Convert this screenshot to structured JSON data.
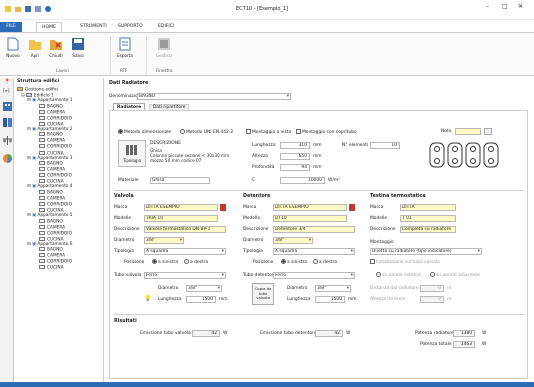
{
  "window": {
    "title": "EC710 - [Esempio_1]",
    "qa_icons": [
      "folder-icon",
      "save-icon",
      "disk-icon",
      "help-icon"
    ]
  },
  "ribbon": {
    "tabs": [
      "FILE",
      "HOME",
      "STRUMENTI",
      "SUPPORTO",
      "EDIFICI"
    ],
    "active_tab": "HOME",
    "groups": [
      {
        "name": "Lavori",
        "buttons": [
          "Nuovo",
          "Apri",
          "Chiudi",
          "Salva"
        ]
      },
      {
        "name": "RTF",
        "buttons": [
          "Esporta"
        ]
      },
      {
        "name": "Finestra",
        "buttons": [
          "Gestisci"
        ]
      }
    ]
  },
  "tree": {
    "header": "Struttura edifici",
    "root": "Gestione edifici",
    "building": "Edificio 1",
    "apartments": [
      {
        "name": "Appartamento 1",
        "rooms": [
          "BAGNO",
          "CAMERA",
          "CORRIDOIO",
          "CUCINA"
        ]
      },
      {
        "name": "Appartamento 2",
        "rooms": [
          "BAGNO",
          "CAMERA",
          "CORRIDOIO",
          "CUCINA"
        ]
      },
      {
        "name": "Appartamento 3",
        "rooms": [
          "BAGNO",
          "CAMERA",
          "CORRIDOIO",
          "CUCINA"
        ]
      },
      {
        "name": "Appartamento 4",
        "rooms": [
          "BAGNO",
          "CAMERA",
          "CORRIDOIO",
          "CUCINA"
        ]
      },
      {
        "name": "Appartamento 5",
        "rooms": [
          "BAGNO",
          "CAMERA",
          "CORRIDOIO",
          "CUCINA"
        ]
      },
      {
        "name": "Appartamento 6",
        "rooms": [
          "BAGNO",
          "CAMERA",
          "CORRIDOIO",
          "CUCINA"
        ]
      }
    ]
  },
  "panel": {
    "title": "Dati Radiatore",
    "denominazione_label": "Denominazione",
    "denominazione_value": "BAGNO",
    "tabs": [
      "Radiatore",
      "Dati ripartitore"
    ],
    "method_1": "Metodo dimensionale",
    "method_2": "Metodo UNI EN 442-2",
    "mont_vista": "Montaggio a vista",
    "mont_copri": "Montaggio con copritubo",
    "note_label": "Note",
    "tipologia_btn": "Tipologia",
    "descr_title": "DESCRIZIONE",
    "descr_text": "Ghisa\nColonne piccole sezione < 30x30 mm\nmozzo 50 mm codice 07",
    "lunghezza_label": "Lunghezza",
    "lunghezza_value": "310",
    "lunghezza_unit": "mm",
    "elementi_label": "N° elementi",
    "elementi_value": "10",
    "altezza_label": "Altezza",
    "altezza_value": "650",
    "altezza_unit": "mm",
    "profondita_label": "Profondità",
    "profondita_value": "94",
    "profondita_unit": "mm",
    "materiale_label": "Materiale",
    "materiale_value": "Ghisa",
    "c_label": "C",
    "c_value": "10000",
    "c_unit": "W/m²"
  },
  "valvola": {
    "title": "Valvola",
    "marca_label": "Marca",
    "marca": "DITTA ESEMPIO",
    "modello_label": "Modello",
    "modello": "TRIA 10",
    "denom_label": "Descrizione",
    "denom": "Valvola termostatica DN BP-1",
    "diametro_label": "Diametro",
    "diametro": "3/8\"",
    "tipologia_label": "Tipologia",
    "tipologia": "A squadra",
    "posizione_label": "Posizione",
    "pos_1": "a sinistra",
    "pos_2": "a destra",
    "tubo_label": "Tubo valvola",
    "tubo": "Ferro",
    "diam2_label": "Diametro",
    "diam2": "3/8\"",
    "lung_label": "Lunghezza",
    "lung": "1500",
    "lung_unit": "mm"
  },
  "detentore": {
    "title": "Detentore",
    "marca_label": "Marca",
    "marca": "DITTA ESEMPIO",
    "modello_label": "Modello",
    "modello": "DT10",
    "denom_label": "Descrizione",
    "denom": "Detentore 3/4",
    "diametro_label": "Diametro",
    "diametro": "3/8\"",
    "tipologia_label": "Tipologia",
    "tipologia": "A squadra",
    "posizione_label": "Posizione",
    "pos_1": "a sinistra",
    "pos_2": "a destra",
    "tubo_label": "Tubo detentore",
    "tubo": "Ferro",
    "copia_btn": "Copia da tubo valvola",
    "diam2_label": "Diametro",
    "diam2": "3/8\"",
    "lung_label": "Lunghezza",
    "lung": "1500",
    "lung_unit": "mm"
  },
  "testina": {
    "title": "Testina termostatica",
    "marca_label": "Marca",
    "marca": "DITTA",
    "modello_label": "Modello",
    "modello": "T 01",
    "denom_label": "Descrizione",
    "denom": "Completa su radiatore",
    "montaggio_title": "Montaggio",
    "montaggio": "Diretto su radiatore (tipo indicatore)",
    "install_chk": "Installazione sul tubo valvola",
    "opt_1": "su parete esterna",
    "opt_2": "su parete adiacente",
    "dist_label": "Distanza dal radiatore",
    "dist_unit": "m",
    "alt_label": "Altezza da terra",
    "alt_unit": "m",
    "zero1": "0",
    "zero2": "0"
  },
  "risultati": {
    "title": "Risultati",
    "emi_valv_label": "Emissione tubo valvola",
    "emi_valv": "42",
    "unit": "W",
    "emi_det_label": "Emissione tubo detentore",
    "emi_det": "42",
    "pot_rad_label": "Potenza radiatore",
    "pot_rad": "1380",
    "pot_tot_label": "Potenza totale",
    "pot_tot": "1463"
  }
}
